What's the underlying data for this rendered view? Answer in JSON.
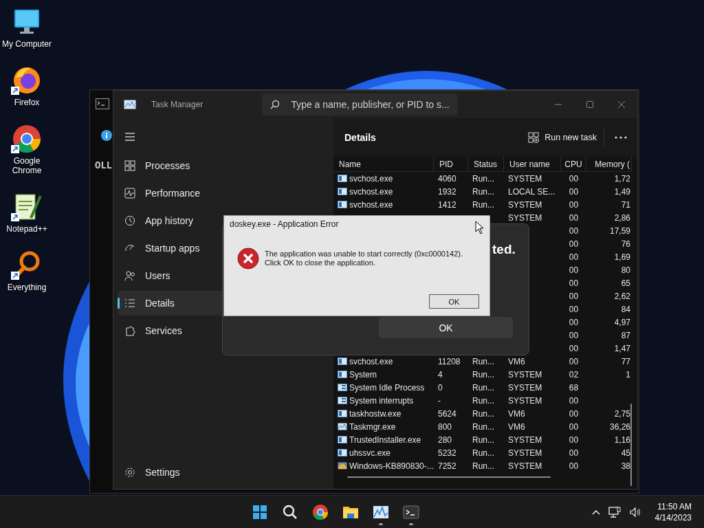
{
  "desktop_icons": [
    {
      "kind": "computer",
      "label": "My Computer"
    },
    {
      "kind": "firefox",
      "label": "Firefox"
    },
    {
      "kind": "chrome",
      "label": "Google Chrome"
    },
    {
      "kind": "notepad",
      "label": "Notepad++"
    },
    {
      "kind": "everything",
      "label": "Everything"
    }
  ],
  "terminal": {
    "text": "OLL"
  },
  "task_manager": {
    "title": "Task Manager",
    "search": {
      "placeholder": "Type a name, publisher, or PID to s..."
    },
    "sidebar": {
      "items": [
        {
          "kind": "processes",
          "label": "Processes",
          "selected": false
        },
        {
          "kind": "performance",
          "label": "Performance",
          "selected": false
        },
        {
          "kind": "history",
          "label": "App history",
          "selected": false
        },
        {
          "kind": "startup",
          "label": "Startup apps",
          "selected": false
        },
        {
          "kind": "users",
          "label": "Users",
          "selected": false
        },
        {
          "kind": "details",
          "label": "Details",
          "selected": true
        },
        {
          "kind": "services",
          "label": "Services",
          "selected": false
        }
      ],
      "settings": "Settings"
    },
    "page_title": "Details",
    "run_new_task": "Run new task",
    "table": {
      "columns": [
        "Name",
        "PID",
        "Status",
        "User name",
        "CPU",
        "Memory ("
      ],
      "rows": [
        {
          "kind": "service",
          "name": "svchost.exe",
          "pid": "4060",
          "status": "Run...",
          "user": "SYSTEM",
          "cpu": "00",
          "memory": "1,72"
        },
        {
          "kind": "service",
          "name": "svchost.exe",
          "pid": "1932",
          "status": "Run...",
          "user": "LOCAL SE...",
          "cpu": "00",
          "memory": "1,49"
        },
        {
          "kind": "service",
          "name": "svchost.exe",
          "pid": "1412",
          "status": "Run...",
          "user": "SYSTEM",
          "cpu": "00",
          "memory": "71"
        },
        {
          "user": "SYSTEM",
          "cpu": "00",
          "memory": "2,86"
        },
        {
          "cpu": "00",
          "memory": "17,59"
        },
        {
          "cpu": "00",
          "memory": "76"
        },
        {
          "cpu": "00",
          "memory": "1,69"
        },
        {
          "cpu": "00",
          "memory": "80"
        },
        {
          "cpu": "00",
          "memory": "65"
        },
        {
          "cpu": "00",
          "memory": "2,62"
        },
        {
          "cpu": "00",
          "memory": "84"
        },
        {
          "cpu": "00",
          "memory": "4,97"
        },
        {
          "cpu": "00",
          "memory": "87"
        },
        {
          "cpu": "00",
          "memory": "1,47"
        },
        {
          "kind": "service",
          "name": "svchost.exe",
          "pid": "11208",
          "status": "Run...",
          "user": "VM6",
          "cpu": "00",
          "memory": "77"
        },
        {
          "kind": "service",
          "name": "System",
          "pid": "4",
          "status": "Run...",
          "user": "SYSTEM",
          "cpu": "02",
          "memory": "1"
        },
        {
          "kind": "app",
          "name": "System Idle Process",
          "pid": "0",
          "status": "Run...",
          "user": "SYSTEM",
          "cpu": "68"
        },
        {
          "kind": "app",
          "name": "System interrupts",
          "pid": "-",
          "status": "Run...",
          "user": "SYSTEM",
          "cpu": "00"
        },
        {
          "kind": "service",
          "name": "taskhostw.exe",
          "pid": "5624",
          "status": "Run...",
          "user": "VM6",
          "cpu": "00",
          "memory": "2,75"
        },
        {
          "kind": "monitor",
          "name": "Taskmgr.exe",
          "pid": "800",
          "status": "Run...",
          "user": "VM6",
          "cpu": "00",
          "memory": "36,26"
        },
        {
          "kind": "service",
          "name": "TrustedInstaller.exe",
          "pid": "280",
          "status": "Run...",
          "user": "SYSTEM",
          "cpu": "00",
          "memory": "1,16"
        },
        {
          "kind": "service",
          "name": "uhssvc.exe",
          "pid": "5232",
          "status": "Run...",
          "user": "SYSTEM",
          "cpu": "00",
          "memory": "45"
        },
        {
          "kind": "setup",
          "name": "Windows-KB890830-...",
          "pid": "7252",
          "status": "Run...",
          "user": "SYSTEM",
          "cpu": "00",
          "memory": "38"
        }
      ]
    }
  },
  "operation_dialog": {
    "heading": "ted.",
    "button": "OK"
  },
  "error_dialog": {
    "title": "doskey.exe - Application Error",
    "message": "The application was unable to start correctly (0xc0000142).\nClick OK to close the application.",
    "button": "OK"
  },
  "taskbar": {
    "apps": [
      {
        "kind": "start",
        "running": false
      },
      {
        "kind": "search",
        "running": false
      },
      {
        "kind": "chrome",
        "running": false
      },
      {
        "kind": "folder",
        "running": false
      },
      {
        "kind": "taskmgr",
        "running": true
      },
      {
        "kind": "terminal",
        "running": true
      }
    ],
    "time": "11:50 AM",
    "date": "4/14/2023"
  }
}
